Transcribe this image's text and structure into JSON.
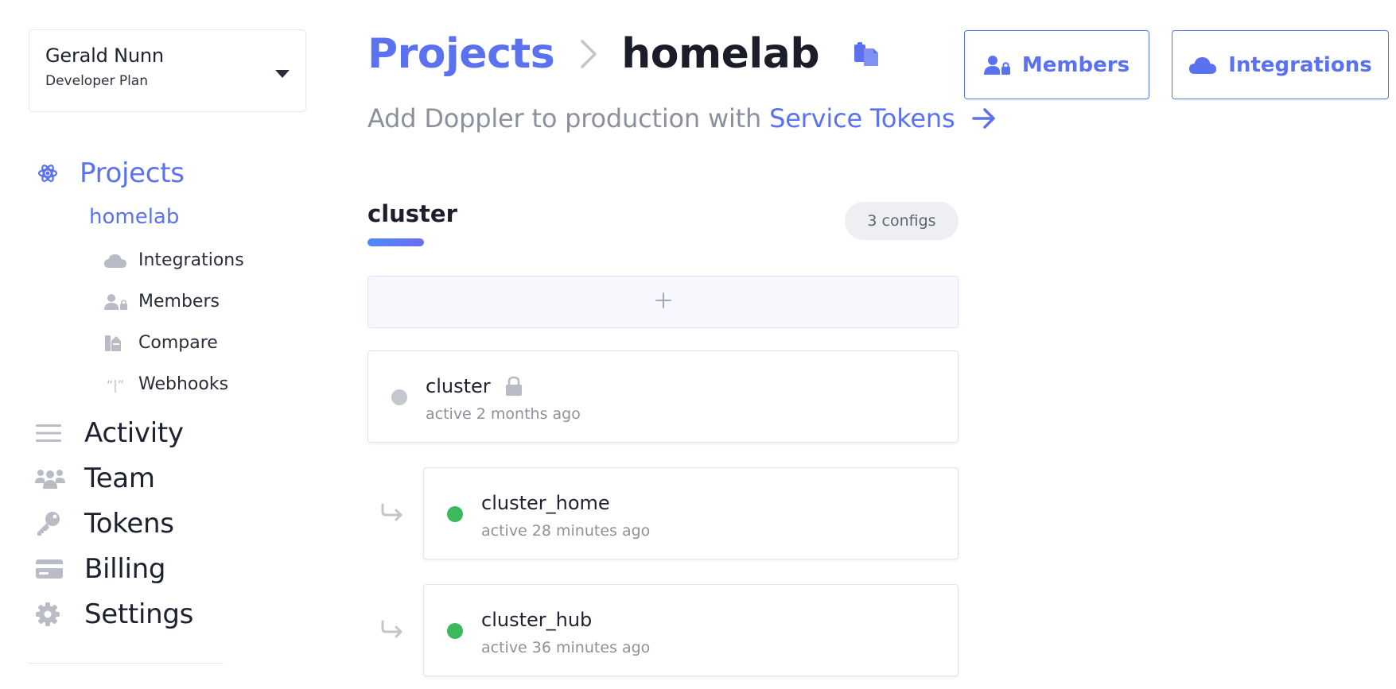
{
  "account": {
    "name": "Gerald Nunn",
    "plan": "Developer Plan"
  },
  "sidebar": {
    "projects_label": "Projects",
    "current_project": "homelab",
    "project_items": [
      {
        "label": "Integrations",
        "icon": "cloud-icon"
      },
      {
        "label": "Members",
        "icon": "members-icon"
      },
      {
        "label": "Compare",
        "icon": "compare-icon"
      },
      {
        "label": "Webhooks",
        "icon": "webhook-icon"
      }
    ],
    "main_items": [
      {
        "label": "Activity",
        "icon": "activity-icon"
      },
      {
        "label": "Team",
        "icon": "team-icon"
      },
      {
        "label": "Tokens",
        "icon": "key-icon"
      },
      {
        "label": "Billing",
        "icon": "credit-card-icon"
      },
      {
        "label": "Settings",
        "icon": "gear-icon"
      }
    ]
  },
  "header": {
    "breadcrumb_root": "Projects",
    "breadcrumb_current": "homelab",
    "subtitle_prefix": "Add Doppler to production with",
    "subtitle_link": "Service Tokens",
    "members_button": "Members",
    "integrations_button": "Integrations"
  },
  "environment": {
    "name": "cluster",
    "config_count": "3 configs",
    "configs": [
      {
        "name": "cluster",
        "status": "active 2 months ago",
        "locked": true,
        "dot_color": "#c5c8ce",
        "branch": false
      },
      {
        "name": "cluster_home",
        "status": "active 28 minutes ago",
        "locked": false,
        "dot_color": "#3cb95c",
        "branch": true
      },
      {
        "name": "cluster_hub",
        "status": "active 36 minutes ago",
        "locked": false,
        "dot_color": "#3cb95c",
        "branch": true
      }
    ]
  },
  "colors": {
    "accent": "#5b72f0",
    "active": "#3cb95c",
    "inactive": "#c5c8ce",
    "muted_icon": "#b9bcc4"
  }
}
